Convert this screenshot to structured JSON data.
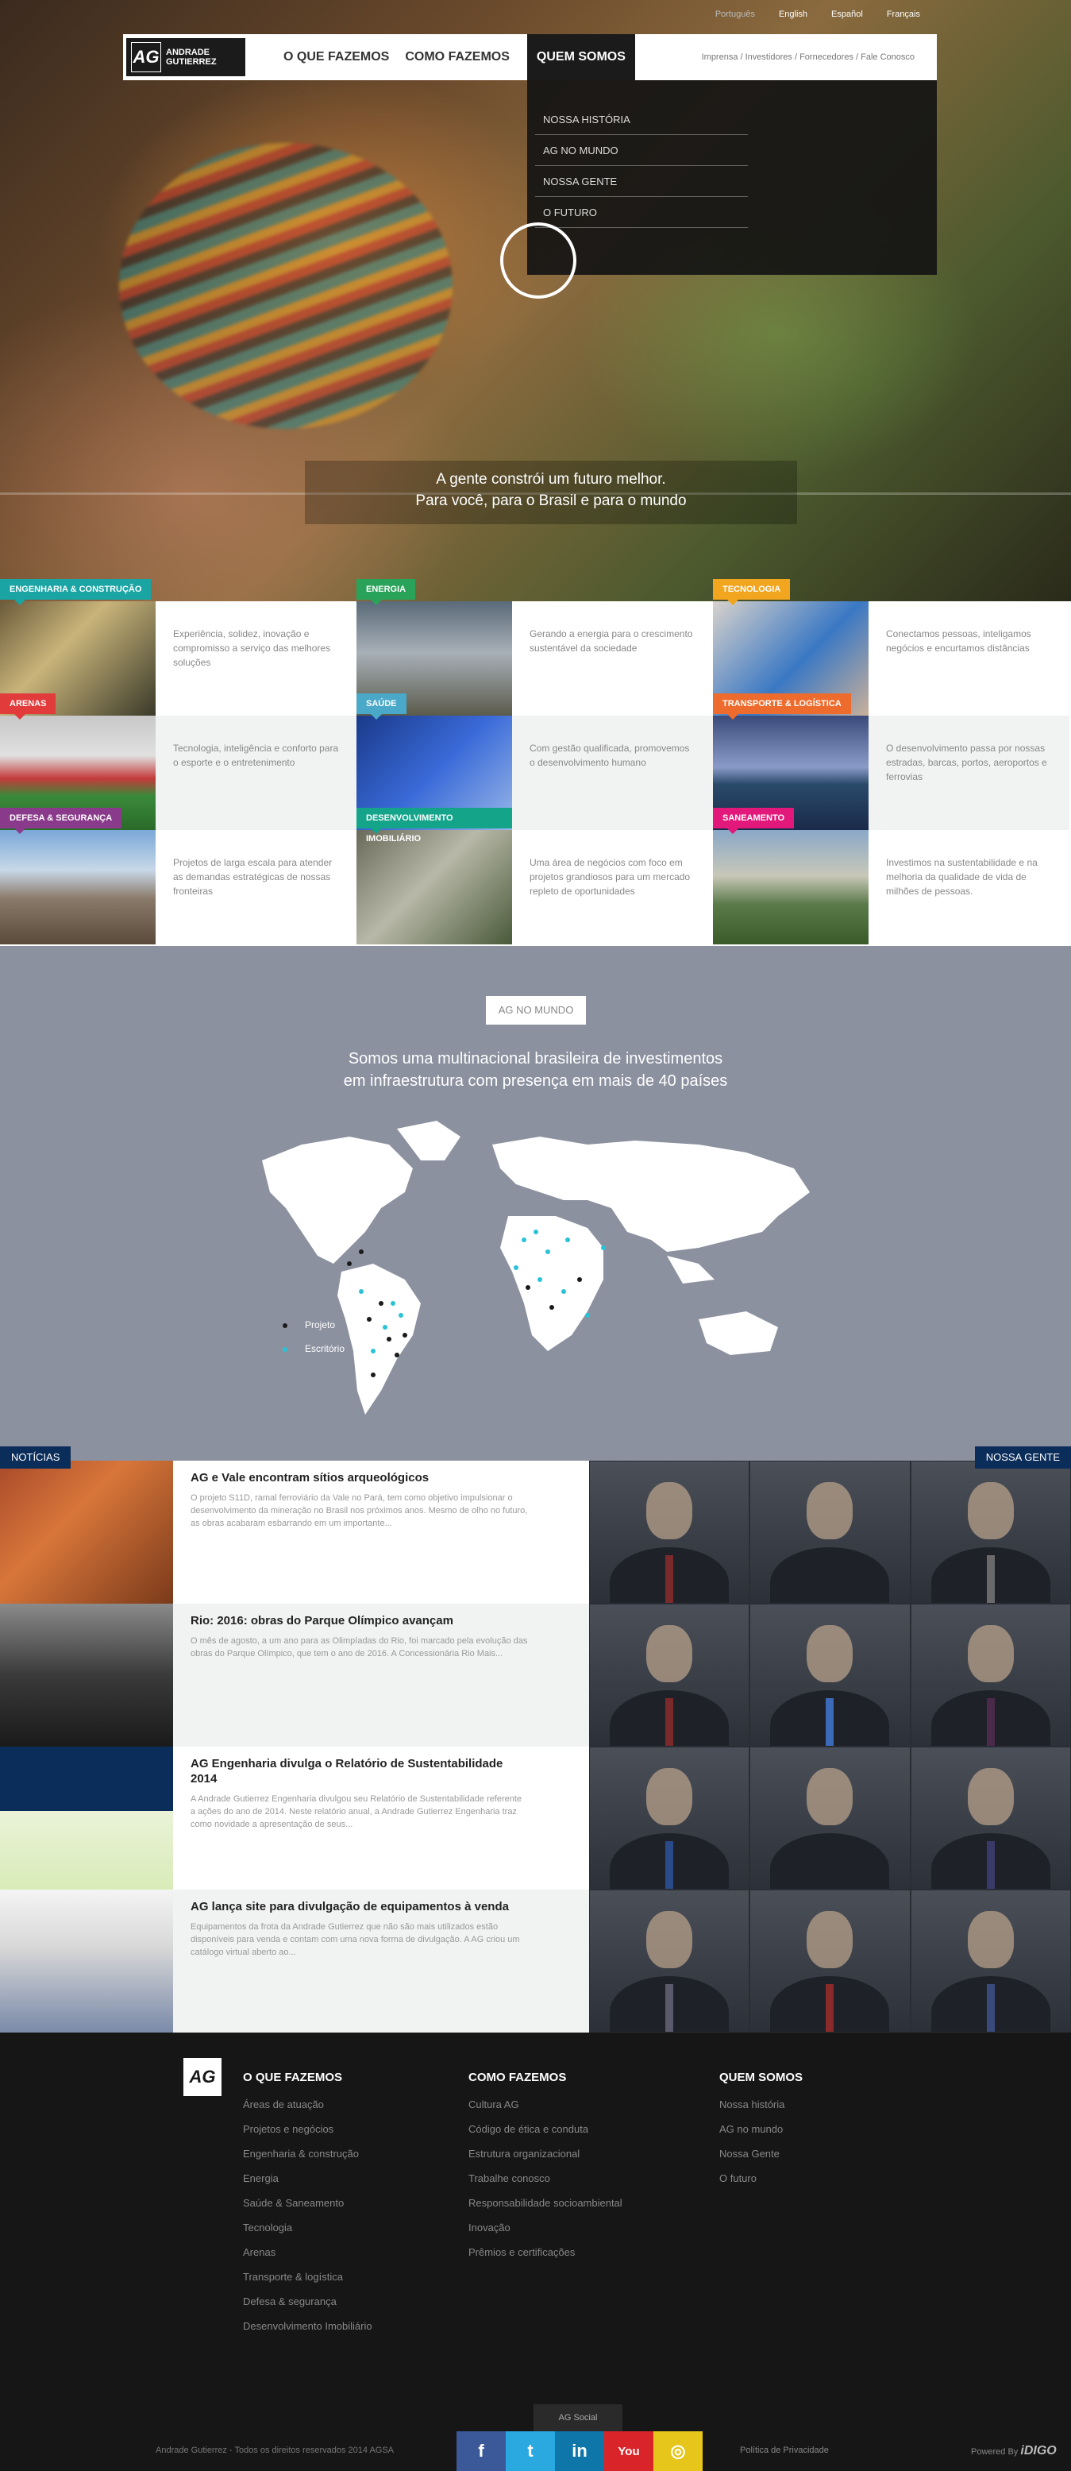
{
  "header": {
    "languages": [
      "Português",
      "English",
      "Español",
      "Français"
    ],
    "logo": {
      "mark": "AG",
      "line1": "ANDRADE",
      "line2": "GUTIERREZ"
    },
    "menu": [
      "O QUE FAZEMOS",
      "COMO FAZEMOS",
      "QUEM SOMOS"
    ],
    "utility_links": "Imprensa / Investidores / Fornecedores / Fale Conosco",
    "dropdown": [
      "NOSSA HISTÓRIA",
      "AG NO MUNDO",
      "NOSSA GENTE",
      "O FUTURO"
    ]
  },
  "hero": {
    "line1": "A gente constrói um futuro melhor.",
    "line2": "Para você, para o Brasil e para o mundo"
  },
  "areas": [
    {
      "tag": "ENGENHARIA & CONSTRUÇÃO",
      "color": "#1aa4a4",
      "text": "Experiência, solidez, inovação e compromisso a serviço das melhores soluções"
    },
    {
      "tag": "ENERGIA",
      "color": "#2aa35a",
      "text": "Gerando a energia para o crescimento sustentável da sociedade"
    },
    {
      "tag": "TECNOLOGIA",
      "color": "#f2a51f",
      "text": "Conectamos pessoas, inteligamos negócios e encurtamos distâncias"
    },
    {
      "tag": "ARENAS",
      "color": "#e23b3b",
      "text": "Tecnologia, inteligência e conforto para o esporte e o entretenimento"
    },
    {
      "tag": "SAÚDE",
      "color": "#4aa8c8",
      "text": "Com gestão qualificada, promovemos o desenvolvimento humano"
    },
    {
      "tag": "TRANSPORTE & LOGÍSTICA",
      "color": "#ec6b2d",
      "text": "O desenvolvimento passa por nossas estradas, barcas, portos, aeroportos e ferrovias"
    },
    {
      "tag": "DEFESA & SEGURANÇA",
      "color": "#8a3a8a",
      "text": "Projetos de larga escala para atender as demandas estratégicas de nossas fronteiras"
    },
    {
      "tag": "DESENVOLVIMENTO IMOBILIÁRIO",
      "color": "#14a48a",
      "text": "Uma área de negócios com foco em projetos grandiosos para um mercado repleto de oportunidades"
    },
    {
      "tag": "SANEAMENTO",
      "color": "#e2187a",
      "text": "Investimos na sustentabilidade e na melhoria da qualidade de vida de milhões de pessoas."
    }
  ],
  "world": {
    "badge": "AG NO MUNDO",
    "title1": "Somos uma multinacional brasileira de investimentos",
    "title2": "em infraestrutura com presença em mais de 40 países",
    "legend": [
      {
        "label": "Projeto",
        "color": "#1b1b1b"
      },
      {
        "label": "Escritório",
        "color": "#29c3d6"
      }
    ]
  },
  "news": {
    "label": "NOTÍCIAS",
    "items": [
      {
        "title": "AG e Vale encontram sítios arqueológicos",
        "text": "O projeto S11D, ramal ferroviário da Vale no Pará, tem como objetivo impulsionar o desenvolvimento da mineração no Brasil nos próximos anos. Mesmo de olho no futuro, as obras acabaram esbarrando em um importante..."
      },
      {
        "title": "Rio: 2016: obras do Parque Olímpico avançam",
        "text": "O mês de agosto, a um ano para as Olimpíadas do Rio, foi marcado pela evolução das obras do Parque Olímpico, que tem o ano de 2016. A Concessionária Rio Mais..."
      },
      {
        "title": "AG Engenharia divulga o Relatório de Sustentabilidade 2014",
        "text": "A Andrade Gutierrez Engenharia divulgou seu Relatório de Sustentabilidade referente a ações do ano de 2014. Neste relatório anual, a Andrade Gutierrez Engenharia traz como novidade a apresentação de seus..."
      },
      {
        "title": "AG lança site para divulgação de equipamentos à venda",
        "text": "Equipamentos da frota da Andrade Gutierrez que não são mais utilizados estão disponíveis para venda e contam com uma nova forma de divulgação. A AG criou um catálogo virtual aberto ao..."
      }
    ]
  },
  "people_label": "NOSSA GENTE",
  "footer": {
    "logo": "AG",
    "cols": [
      {
        "title": "O QUE FAZEMOS",
        "links": [
          "Áreas de atuação",
          "Projetos e negócios",
          "Engenharia & construção",
          "Energia",
          "Saúde & Saneamento",
          "Tecnologia",
          "Arenas",
          "Transporte & logística",
          "Defesa & segurança",
          "Desenvolvimento Imobiliário"
        ]
      },
      {
        "title": "COMO FAZEMOS",
        "links": [
          "Cultura AG",
          "Código de ética e conduta",
          "Estrutura organizacional",
          "Trabalhe conosco",
          "Responsabilidade socioambiental",
          "Inovação",
          "Prêmios e certificações"
        ]
      },
      {
        "title": "QUEM SOMOS",
        "links": [
          "Nossa história",
          "AG no mundo",
          "Nossa Gente",
          "O futuro"
        ]
      }
    ],
    "social_label": "AG Social",
    "social": [
      {
        "icon": "facebook-icon",
        "glyph": "f",
        "color": "#3b5998"
      },
      {
        "icon": "twitter-icon",
        "glyph": "t",
        "color": "#2aa9e0"
      },
      {
        "icon": "linkedin-icon",
        "glyph": "in",
        "color": "#0e76a8"
      },
      {
        "icon": "youtube-icon",
        "glyph": "You",
        "color": "#d9252a"
      },
      {
        "icon": "instagram-icon",
        "glyph": "◎",
        "color": "#e6c61a"
      }
    ],
    "copyright": "Andrade Gutierrez - Todos os direitos reservados 2014 AGSA",
    "privacy": "Política de Privacidade",
    "powered": "Powered By",
    "powered_brand": "iDIGO"
  }
}
